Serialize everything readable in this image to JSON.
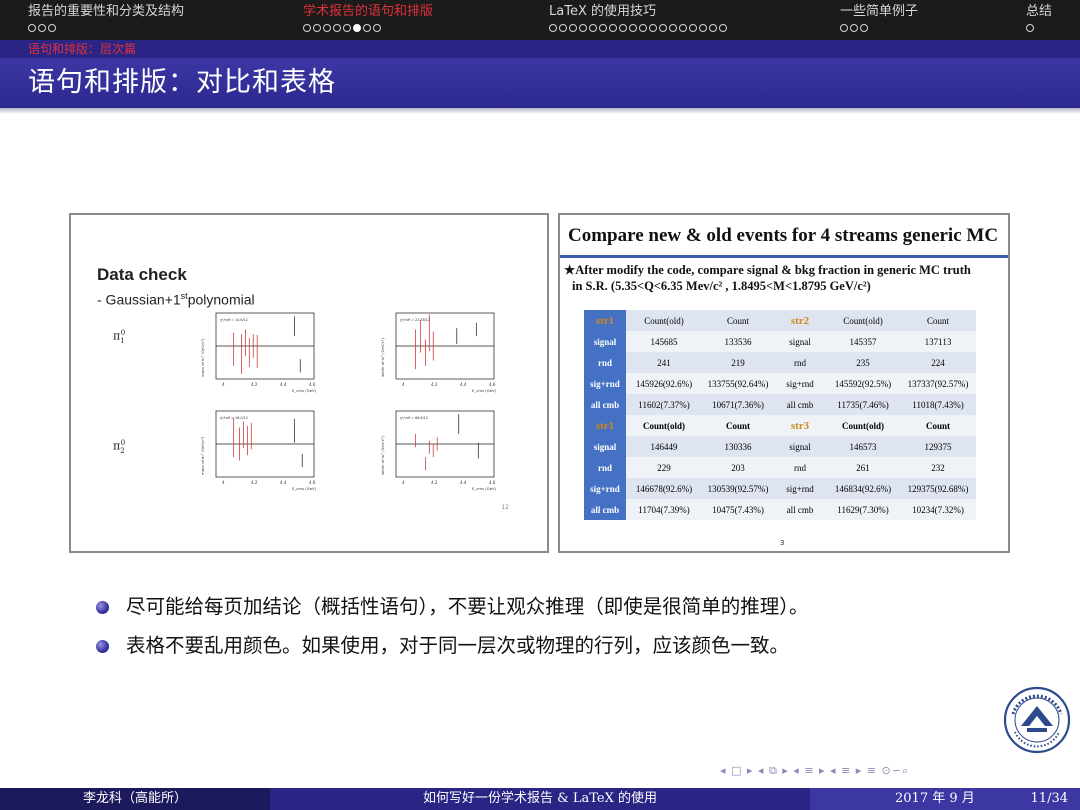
{
  "nav": {
    "sections": [
      {
        "label": "报告的重要性和分类及结构",
        "dots": 3,
        "filled": -1,
        "active": false
      },
      {
        "label": "学术报告的语句和排版",
        "dots": 8,
        "filled": 5,
        "active": true
      },
      {
        "label": "LaTeX 的使用技巧",
        "dots": 18,
        "filled": -1,
        "active": false
      },
      {
        "label": "一些简单例子",
        "dots": 3,
        "filled": -1,
        "active": false
      },
      {
        "label": "总结",
        "dots": 1,
        "filled": -1,
        "active": false
      }
    ]
  },
  "subsection": "语句和排版：层次篇",
  "frame_title": "语句和排版：对比和表格",
  "left_image": {
    "title": "Data check",
    "subtitle_pre": "- Gaussian+1",
    "subtitle_sup": "st",
    "subtitle_post": "polynomial",
    "row_labels": [
      "π",
      "π"
    ],
    "row_label_sup": "0",
    "row_label_subs": [
      "1",
      "2"
    ],
    "plots": [
      {
        "ylabel": "mass of π₁⁰ (GeV/c²)",
        "fit": "χ²/ndf = 14.6/12",
        "xlabel": "E_cms (GeV)"
      },
      {
        "ylabel": "width of π₁⁰ (GeV/c²)",
        "fit": "χ²/ndf = 22.78/12",
        "xlabel": "E_cms (GeV)"
      },
      {
        "ylabel": "mass of π₂⁰ (GeV/c²)",
        "fit": "χ²/ndf = 16.0/12",
        "xlabel": "E_cms (GeV)"
      },
      {
        "ylabel": "width of π₂⁰ (GeV/c²)",
        "fit": "χ²/ndf = 66.8/12",
        "xlabel": "E_cms (GeV)"
      }
    ],
    "xticks": [
      "4",
      "4.2",
      "4.4",
      "4.6"
    ],
    "page_number": "12"
  },
  "right_image": {
    "title": "Compare new & old events for 4 streams generic MC",
    "note_line1": "★After modify the code, compare signal & bkg fraction in generic MC truth",
    "note_line2": "in S.R. (5.35<Q<6.35 Mev/c² , 1.8495<M<1.8795 GeV/c²)",
    "table": {
      "rows": [
        {
          "style": "plain",
          "cells": [
            "str1",
            "Count(old)",
            "Count",
            "str2",
            "Count(old)",
            "Count"
          ]
        },
        {
          "style": "plain",
          "cells": [
            "signal",
            "145685",
            "133536",
            "signal",
            "145357",
            "137113"
          ]
        },
        {
          "style": "plain",
          "cells": [
            "rnd",
            "241",
            "219",
            "rnd",
            "235",
            "224"
          ]
        },
        {
          "style": "plain",
          "cells": [
            "sig+rnd",
            "145926(92.6%)",
            "133755(92.64%)",
            "sig+rnd",
            "145592(92.5%)",
            "137337(92.57%)"
          ]
        },
        {
          "style": "plain",
          "cells": [
            "all cmb",
            "11602(7.37%)",
            "10671(7.36%)",
            "all cmb",
            "11735(7.46%)",
            "11018(7.43%)"
          ]
        },
        {
          "style": "bold",
          "cells": [
            "str1",
            "Count(old)",
            "Count",
            "str3",
            "Count(old)",
            "Count"
          ]
        },
        {
          "style": "plain",
          "cells": [
            "signal",
            "146449",
            "130336",
            "signal",
            "146573",
            "129375"
          ]
        },
        {
          "style": "plain",
          "cells": [
            "rnd",
            "229",
            "203",
            "rnd",
            "261",
            "232"
          ]
        },
        {
          "style": "plain",
          "cells": [
            "sig+rnd",
            "146678(92.6%)",
            "130539(92.57%)",
            "sig+rnd",
            "146834(92.6%)",
            "129375(92.68%)"
          ]
        },
        {
          "style": "plain",
          "cells": [
            "all cmb",
            "11704(7.39%)",
            "10475(7.43%)",
            "all cmb",
            "11629(7.30%)",
            "10234(7.32%)"
          ]
        }
      ]
    },
    "page_number": "3"
  },
  "bullets": [
    "尽可能给每页加结论（概括性语句），不要让观众推理（即使是很简单的推理）。",
    "表格不要乱用颜色。如果使用，对于同一层次或物理的行列，应该颜色一致。"
  ],
  "nav_symbols": "◂ □ ▸ ◂ ⧉ ▸ ◂ ≡ ▸ ◂ ≡ ▸ ≡ ⊙∽⌕",
  "footer": {
    "author": "李龙科（高能所）",
    "title": "如何写好一份学术报告 & LaTeX 的使用",
    "date": "2017 年 9 月",
    "page": "11/34"
  },
  "colors": {
    "nav_bg": "#1b1b1b",
    "theme_dark": "#1c1a5c",
    "theme_mid": "#2a2585",
    "theme_light": "#3c37a3",
    "active_red": "#e0303a",
    "table_header_blue": "#4471c4",
    "stream_orange": "#d0881a"
  }
}
